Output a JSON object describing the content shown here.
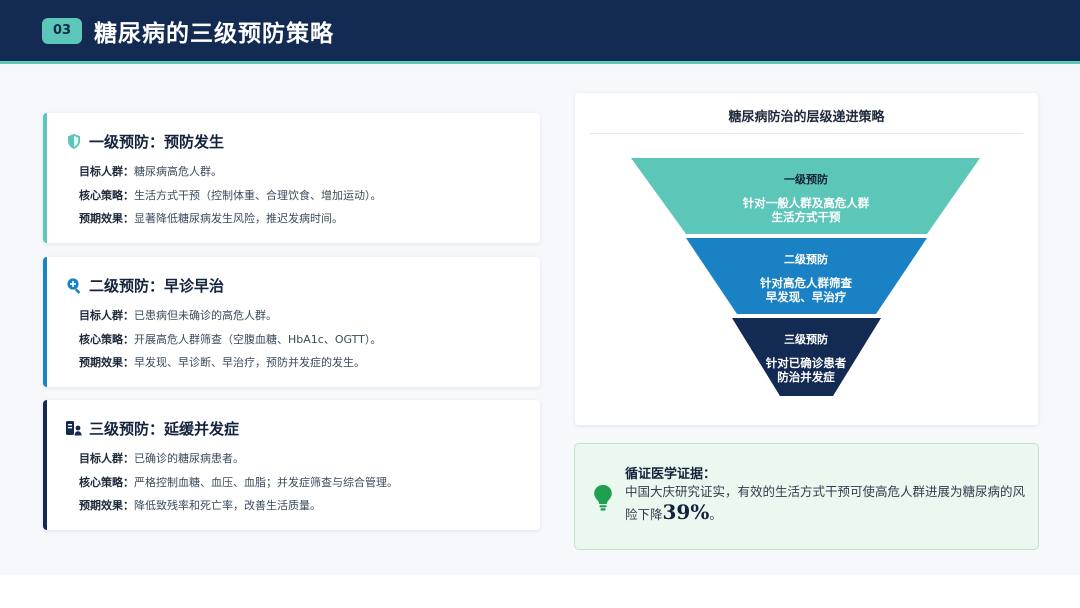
{
  "header": {
    "badge": "03",
    "title": "糖尿病的三级预防策略"
  },
  "cards": [
    {
      "icon": "shield-icon",
      "title": "一级预防：预防发生",
      "rows": [
        {
          "label": "目标人群：",
          "value": "糖尿病高危人群。"
        },
        {
          "label": "核心策略：",
          "value": "生活方式干预（控制体重、合理饮食、增加运动）。"
        },
        {
          "label": "预期效果：",
          "value": "显著降低糖尿病发生风险，推迟发病时间。"
        }
      ]
    },
    {
      "icon": "search-plus-icon",
      "title": "二级预防：早诊早治",
      "rows": [
        {
          "label": "目标人群：",
          "value": "已患病但未确诊的高危人群。"
        },
        {
          "label": "核心策略：",
          "value": "开展高危人群筛查（空腹血糖、HbA1c、OGTT）。"
        },
        {
          "label": "预期效果：",
          "value": "早发现、早诊断、早治疗，预防并发症的发生。"
        }
      ]
    },
    {
      "icon": "patient-care-icon",
      "title": "三级预防：延缓并发症",
      "rows": [
        {
          "label": "目标人群：",
          "value": "已确诊的糖尿病患者。"
        },
        {
          "label": "核心策略：",
          "value": "严格控制血糖、血压、血脂；并发症筛查与综合管理。"
        },
        {
          "label": "预期效果：",
          "value": "降低致残率和死亡率，改善生活质量。"
        }
      ]
    }
  ],
  "funnel": {
    "title": "糖尿病防治的层级递进策略",
    "levels": [
      {
        "name": "一级预防",
        "line1": "针对一般人群及高危人群",
        "line2": "生活方式干预"
      },
      {
        "name": "二级预防",
        "line1": "针对高危人群筛查",
        "line2": "早发现、早治疗"
      },
      {
        "name": "三级预防",
        "line1": "针对已确诊患者",
        "line2": "防治并发症"
      }
    ]
  },
  "evidence": {
    "icon": "lightbulb-icon",
    "title": "循证医学证据：",
    "text": "中国大庆研究证实，有效的生活方式干预可使高危人群进展为糖尿病的风险下降",
    "highlight": "39%",
    "suffix": "。"
  },
  "colors": {
    "navy": "#132a52",
    "teal": "#5cc6b8",
    "blue": "#1a82c4",
    "green": "#1fa04f"
  }
}
